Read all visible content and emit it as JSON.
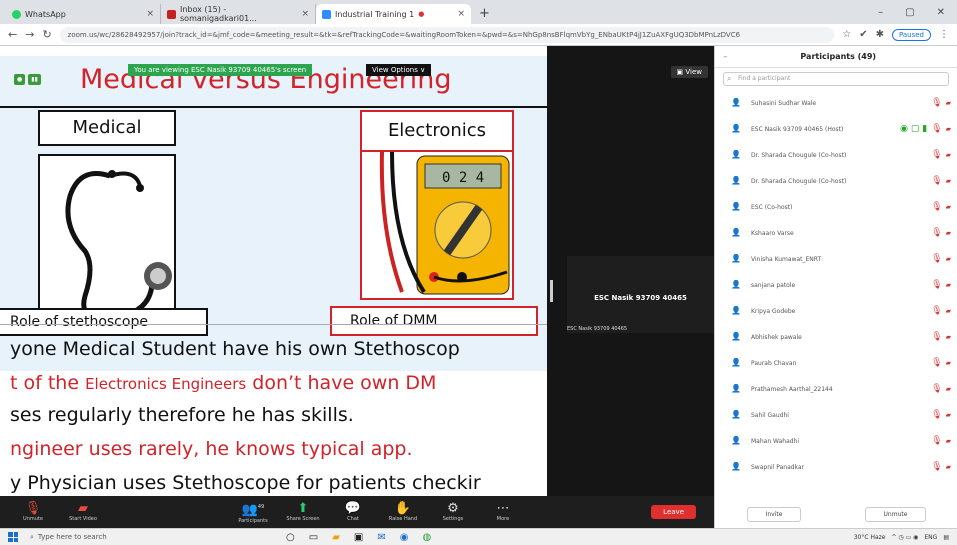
{
  "browser": {
    "tabs": [
      {
        "label": "WhatsApp",
        "color": "#25d366"
      },
      {
        "label": "Inbox (15) - somanigadkari01...",
        "color": "#c5221f"
      },
      {
        "label": "Industrial Training 1",
        "color": "#2d8cff"
      }
    ],
    "url": "zoom.us/wc/28628492957/join?track_id=&jmf_code=&meeting_result=&tk=&refTrackingCode=&waitingRoomToken=&pwd=&s=NhGp8nsBFlqmVbYg_ENbaUKtP4jJ1ZuAXFgUQ3DbMPnLzDVC6",
    "paused_label": "Paused"
  },
  "share": {
    "banner": "You are viewing ESC Nasik 93709 40465's screen",
    "view_options": "View Options ∨",
    "slide": {
      "title": "Medical versus Engineering",
      "medical_label": "Medical",
      "electronics_label": "Electronics",
      "steth_label": "Role of stethoscope",
      "dmm_label": "Role of DMM",
      "dmm_display": "0 2 4",
      "line1": "yone Medical Student have his own Stethoscop",
      "line2a": "t of the ",
      "line2b": "Electronics Engineers",
      "line2c": " don’t have own DM",
      "line3": "ses regularly therefore he has skills.",
      "line4": "ngineer uses rarely, he knows typical app.",
      "line5": "y Physician uses Stethoscope for patients checkir"
    }
  },
  "video": {
    "view_label": "View",
    "tile_name": "ESC Nasik 93709 40465",
    "tile_sub": "ESC Nasik 93709 40465"
  },
  "toolbar": {
    "buttons": [
      {
        "label": "Unmute",
        "icon": "mic-muted-icon"
      },
      {
        "label": "Start Video",
        "icon": "video-off-icon"
      },
      {
        "label": "Participants",
        "icon": "participants-icon"
      },
      {
        "label": "Share Screen",
        "icon": "share-screen-icon"
      },
      {
        "label": "Chat",
        "icon": "chat-icon"
      },
      {
        "label": "Raise Hand",
        "icon": "raise-hand-icon"
      },
      {
        "label": "Settings",
        "icon": "settings-icon"
      },
      {
        "label": "More",
        "icon": "more-icon"
      }
    ],
    "participant_count": "49",
    "leave_label": "Leave"
  },
  "participants": {
    "title": "Participants (49)",
    "find_placeholder": "Find a participant",
    "list": [
      {
        "name": "Suhasini Sudhar Wale"
      },
      {
        "name": "ESC Nasik 93709 40465 (Host)",
        "host": true
      },
      {
        "name": "Dr. Sharada Chougule (Co-host)"
      },
      {
        "name": "Dr. Sharada Chougule (Co-host)"
      },
      {
        "name": "ESC (Co-host)"
      },
      {
        "name": "Kshaaro Varse"
      },
      {
        "name": "Vinisha Kumawat_ENRT"
      },
      {
        "name": "sanjana patole"
      },
      {
        "name": "Kripya Godebe"
      },
      {
        "name": "Abhishek pawale"
      },
      {
        "name": "Paurab Chavan"
      },
      {
        "name": "Prathamesh Aarthal_22144"
      },
      {
        "name": "Sahil Gaudhi"
      },
      {
        "name": "Mahan Wahadhi"
      },
      {
        "name": "Swapnil Panadkar"
      }
    ],
    "invite_label": "Invite",
    "unmute_label": "Unmute"
  },
  "taskbar": {
    "search_placeholder": "Type here to search",
    "weather": "30°C Haze",
    "lang": "ENG"
  }
}
